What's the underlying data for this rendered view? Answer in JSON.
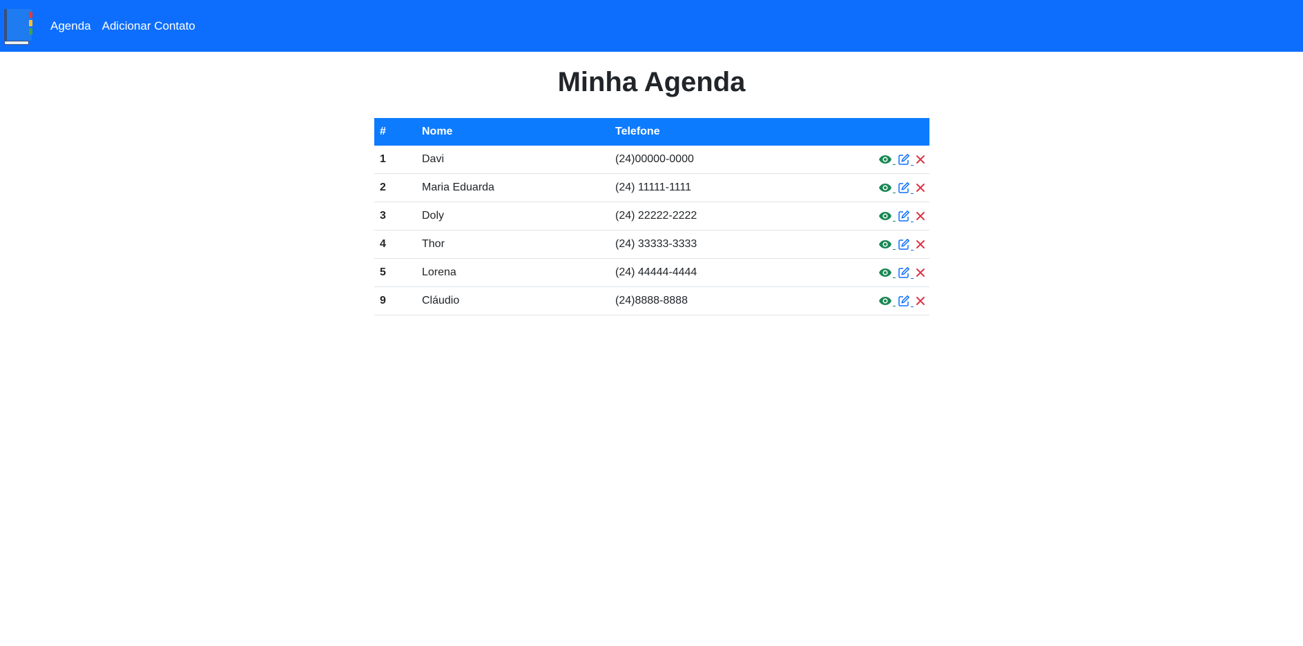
{
  "nav": {
    "links": [
      {
        "label": "Agenda"
      },
      {
        "label": "Adicionar Contato"
      }
    ]
  },
  "page": {
    "title": "Minha Agenda"
  },
  "table": {
    "headers": {
      "index": "#",
      "name": "Nome",
      "phone": "Telefone",
      "actions": ""
    },
    "rows": [
      {
        "id": "1",
        "name": "Davi",
        "phone": "(24)00000-0000"
      },
      {
        "id": "2",
        "name": "Maria Eduarda",
        "phone": "(24) 11111-1111"
      },
      {
        "id": "3",
        "name": "Doly",
        "phone": "(24) 22222-2222"
      },
      {
        "id": "4",
        "name": "Thor",
        "phone": "(24) 33333-3333"
      },
      {
        "id": "5",
        "name": "Lorena",
        "phone": "(24) 44444-4444"
      },
      {
        "id": "9",
        "name": "Cláudio",
        "phone": "(24)8888-8888"
      }
    ],
    "row_actions": [
      {
        "icon": "eye-icon",
        "color": "#198754"
      },
      {
        "icon": "edit-icon",
        "color": "#0d6efd"
      },
      {
        "icon": "close-icon",
        "color": "#dc3545"
      }
    ]
  },
  "colors": {
    "navbar": "#0d6efd",
    "table_header": "#0d7bfd"
  }
}
